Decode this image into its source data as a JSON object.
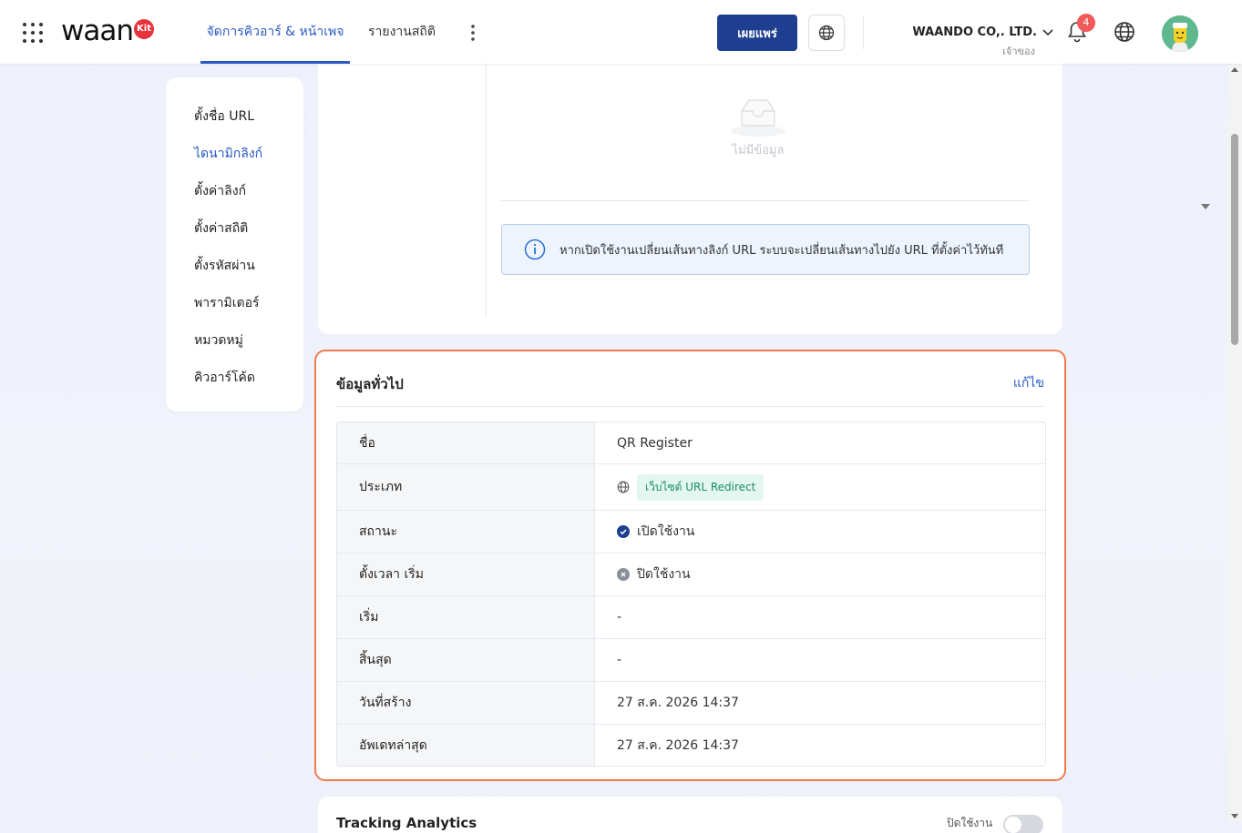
{
  "header": {
    "logo_text": "waan",
    "logo_badge": "Kit",
    "tabs": [
      {
        "label": "จัดการคิวอาร์ & หน้าเพจ",
        "active": true
      },
      {
        "label": "รายงานสถิติ",
        "active": false
      }
    ],
    "publish_label": "เผยแพร่",
    "company_name": "WAANDO CO,. LTD.",
    "company_role": "เจ้าของ",
    "notification_count": "4"
  },
  "sidebar": {
    "items": [
      {
        "label": "ตั้งชื่อ URL",
        "active": false
      },
      {
        "label": "ไดนามิกลิงก์",
        "active": true
      },
      {
        "label": "ตั้งค่าลิงก์",
        "active": false
      },
      {
        "label": "ตั้งค่าสถิติ",
        "active": false
      },
      {
        "label": "ตั้งรหัสผ่าน",
        "active": false
      },
      {
        "label": "พารามิเตอร์",
        "active": false
      },
      {
        "label": "หมวดหมู่",
        "active": false
      },
      {
        "label": "คิวอาร์โค้ด",
        "active": false
      }
    ]
  },
  "redirect_panel": {
    "empty_text": "ไม่มีข้อมูล",
    "info_text": "หากเปิดใช้งานเปลี่ยนเส้นทางลิงก์ URL ระบบจะเปลี่ยนเส้นทางไปยัง URL ที่ตั้งค่าไว้ทันที"
  },
  "general": {
    "title": "ข้อมูลทั่วไป",
    "edit_label": "แก้ไข",
    "rows": [
      {
        "label": "ชื่อ",
        "value": "QR Register"
      },
      {
        "label": "ประเภท",
        "value": "เว็บไซต์ URL Redirect"
      },
      {
        "label": "สถานะ",
        "value": "เปิดใช้งาน"
      },
      {
        "label": "ตั้งเวลา เริ่ม",
        "value": "ปิดใช้งาน"
      },
      {
        "label": "เริ่ม",
        "value": "-"
      },
      {
        "label": "สิ้นสุด",
        "value": "-"
      },
      {
        "label": "วันที่สร้าง",
        "value": "27 ส.ค. 2026 14:37"
      },
      {
        "label": "อัพเดทล่าสุด",
        "value": "27 ส.ค. 2026 14:37"
      }
    ]
  },
  "tracking": {
    "title": "Tracking Analytics",
    "toggle_label": "ปิดใช้งาน",
    "enabled": false
  },
  "colors": {
    "primary": "#1e3f8f",
    "link": "#2b59c3",
    "highlight_border": "#f07a4f",
    "badge_bg": "#e3f6ef",
    "badge_text": "#1c8f6a"
  }
}
